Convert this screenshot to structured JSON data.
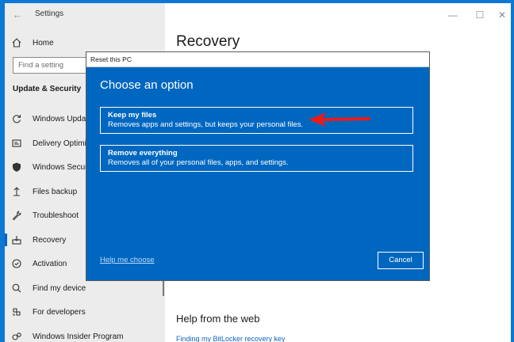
{
  "window": {
    "title": "Settings",
    "controls": [
      "minimize",
      "maximize",
      "close"
    ]
  },
  "sidebar": {
    "home_label": "Home",
    "search_placeholder": "Find a setting",
    "section_title": "Update & Security",
    "items": [
      {
        "label": "Windows Update",
        "icon": "refresh-icon"
      },
      {
        "label": "Delivery Optimization",
        "icon": "delivery-optimization-icon"
      },
      {
        "label": "Windows Security",
        "icon": "shield-icon"
      },
      {
        "label": "Files backup",
        "icon": "backup-icon"
      },
      {
        "label": "Troubleshoot",
        "icon": "wrench-icon"
      },
      {
        "label": "Recovery",
        "icon": "recovery-icon",
        "active": true
      },
      {
        "label": "Activation",
        "icon": "activation-icon"
      },
      {
        "label": "Find my device",
        "icon": "find-device-icon"
      },
      {
        "label": "For developers",
        "icon": "developers-icon"
      },
      {
        "label": "Windows Insider Program",
        "icon": "insider-icon"
      }
    ]
  },
  "main": {
    "title": "Recovery",
    "help_heading": "Help from the web",
    "help_link": "Finding my BitLocker recovery key"
  },
  "dialog": {
    "title": "Reset this PC",
    "heading": "Choose an option",
    "options": [
      {
        "title": "Keep my files",
        "description": "Removes apps and settings, but keeps your personal files."
      },
      {
        "title": "Remove everything",
        "description": "Removes all of your personal files, apps, and settings."
      }
    ],
    "help_link": "Help me choose",
    "cancel_label": "Cancel"
  },
  "colors": {
    "desktop": "#0a78d4",
    "dialog_bg": "#0067c0",
    "sidebar_bg": "#ececec",
    "annotation_arrow": "#e81b1b"
  }
}
